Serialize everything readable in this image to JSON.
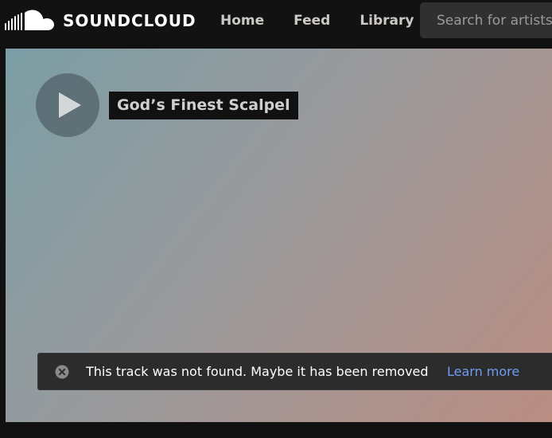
{
  "header": {
    "brand": "SOUNDCLOUD",
    "logo_icon": "soundcloud-cloud-icon",
    "nav": [
      {
        "label": "Home"
      },
      {
        "label": "Feed"
      },
      {
        "label": "Library"
      }
    ],
    "search_placeholder": "Search for artists, bands, tracks, podcasts"
  },
  "track": {
    "title": "God’s Finest Scalpel",
    "play_icon": "play-icon"
  },
  "notification": {
    "icon": "close-circle-icon",
    "message": "This track was not found. Maybe it has been removed",
    "link_label": "Learn more"
  },
  "colors": {
    "header_bg": "#121212",
    "link": "#6f9cf2",
    "hero_gradient_start": "#7b9ea5",
    "hero_gradient_end": "#bb8d82"
  }
}
